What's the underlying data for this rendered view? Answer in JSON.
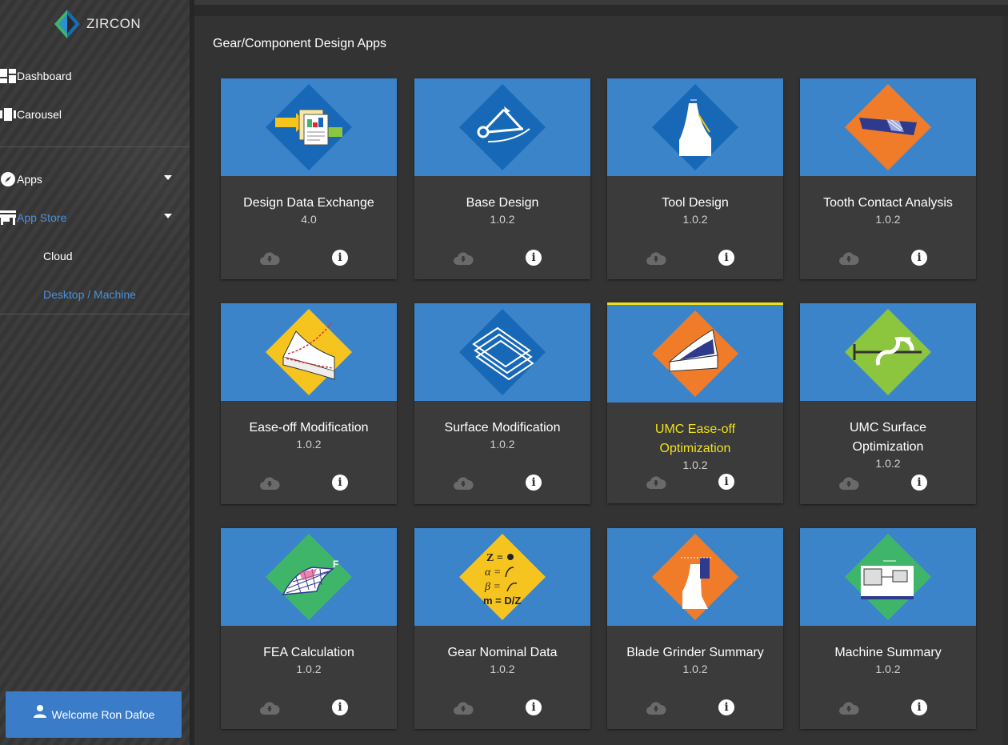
{
  "app": {
    "logo_text": "ZIRCON"
  },
  "sidebar": {
    "items": [
      {
        "label": "Dashboard",
        "icon": "dashboard-icon"
      },
      {
        "label": "Carousel",
        "icon": "carousel-icon"
      },
      {
        "label": "Apps",
        "icon": "compass-icon"
      },
      {
        "label": "App Store",
        "icon": "store-icon"
      }
    ],
    "subitems": [
      {
        "label": "Cloud"
      },
      {
        "label": "Desktop / Machine"
      }
    ],
    "welcome": "Welcome Ron Dafoe"
  },
  "main": {
    "section_title": "Gear/Component Design Apps",
    "apps": [
      {
        "name": "Design Data Exchange",
        "version": "4.0",
        "icon": "data-exchange-icon",
        "diamond": "#1769b8"
      },
      {
        "name": "Base Design",
        "version": "1.0.2",
        "icon": "base-design-icon",
        "diamond": "#1769b8"
      },
      {
        "name": "Tool Design",
        "version": "1.0.2",
        "icon": "tool-design-icon",
        "diamond": "#1769b8"
      },
      {
        "name": "Tooth Contact Analysis",
        "version": "1.0.2",
        "icon": "tooth-contact-icon",
        "diamond": "#f07c2a"
      },
      {
        "name": "Ease-off Modification",
        "version": "1.0.2",
        "icon": "ease-off-icon",
        "diamond": "#f6c41e"
      },
      {
        "name": "Surface Modification",
        "version": "1.0.2",
        "icon": "surface-mod-icon",
        "diamond": "#1769b8"
      },
      {
        "name": "UMC Ease-off Optimization",
        "version": "1.0.2",
        "icon": "umc-ease-off-icon",
        "diamond": "#f07c2a"
      },
      {
        "name": "UMC Surface Optimization",
        "version": "1.0.2",
        "icon": "umc-surface-icon",
        "diamond": "#8cc63f"
      },
      {
        "name": "FEA Calculation",
        "version": "1.0.2",
        "icon": "fea-icon",
        "diamond": "#3fb56a"
      },
      {
        "name": "Gear Nominal Data",
        "version": "1.0.2",
        "icon": "nominal-data-icon",
        "diamond": "#f6c41e"
      },
      {
        "name": "Blade Grinder Summary",
        "version": "1.0.2",
        "icon": "blade-grinder-icon",
        "diamond": "#f07c2a"
      },
      {
        "name": "Machine Summary",
        "version": "1.0.2",
        "icon": "machine-icon",
        "diamond": "#3fb56a"
      }
    ]
  }
}
